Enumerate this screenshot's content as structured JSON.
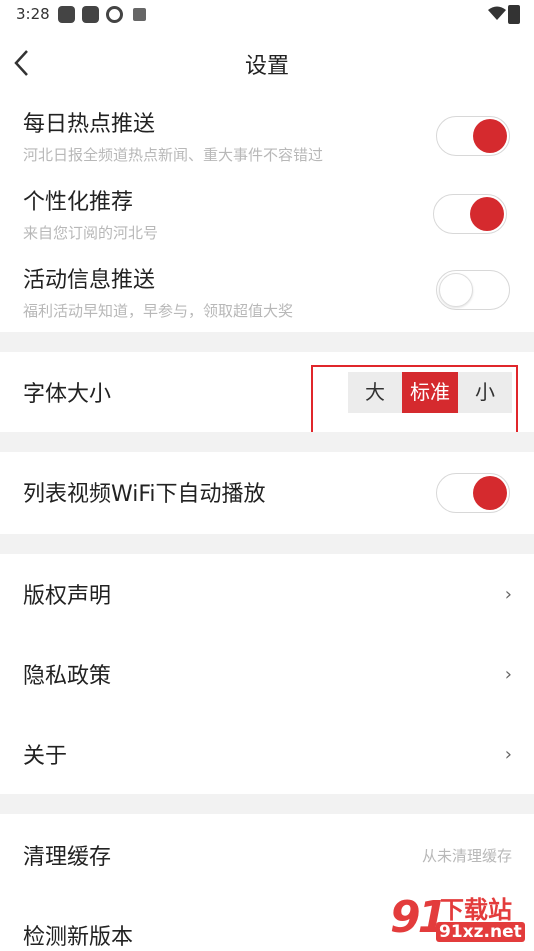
{
  "status_bar": {
    "time": "3:28"
  },
  "nav": {
    "title": "设置"
  },
  "push": [
    {
      "title": "每日热点推送",
      "subtitle": "河北日报全频道热点新闻、重大事件不容错过",
      "on": true
    },
    {
      "title": "个性化推荐",
      "subtitle": "来自您订阅的河北号",
      "on": true
    },
    {
      "title": "活动信息推送",
      "subtitle": "福利活动早知道，早参与，领取超值大奖",
      "on": false
    }
  ],
  "font_size": {
    "label": "字体大小",
    "options": [
      "大",
      "标准",
      "小"
    ],
    "selected": "标准"
  },
  "autoplay": {
    "label": "列表视频WiFi下自动播放",
    "on": true
  },
  "links": [
    {
      "label": "版权声明",
      "chevron": "›"
    },
    {
      "label": "隐私政策",
      "chevron": "›"
    },
    {
      "label": "关于",
      "chevron": "›"
    }
  ],
  "cache": {
    "label": "清理缓存",
    "value": "从未清理缓存"
  },
  "update": {
    "label": "检测新版本"
  },
  "watermark": {
    "logo": "91",
    "brand": "下载站",
    "url": "91xz.net"
  },
  "colors": {
    "accent": "#d52a2e",
    "divider": "#f2f2f2",
    "subtext": "#b8b8b8"
  }
}
